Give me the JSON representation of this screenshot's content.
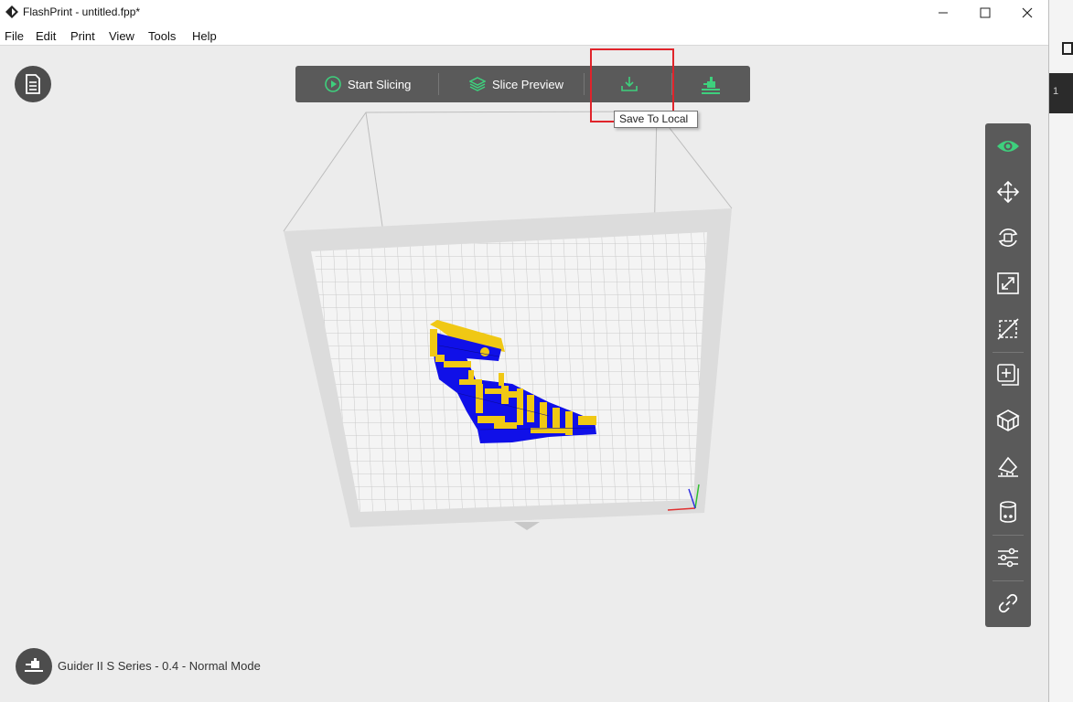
{
  "window": {
    "title": "FlashPrint - untitled.fpp*",
    "minimize_icon": "minimize-icon",
    "maximize_icon": "maximize-icon",
    "close_icon": "close-icon"
  },
  "menu": [
    "File",
    "Edit",
    "Print",
    "View",
    "Tools",
    "Help"
  ],
  "toolbar": {
    "start_slicing": "Start Slicing",
    "slice_preview": "Slice Preview",
    "save_local_icon": "download-icon",
    "send_icon": "printer-send-icon"
  },
  "tooltip": "Save To Local",
  "right_panel": [
    "eye-icon",
    "move-icon",
    "rotate-icon",
    "scale-icon",
    "cut-icon",
    "add-model-icon",
    "supports-icon",
    "lay-flat-icon",
    "cylinder-icon",
    "settings-sliders-icon",
    "link-icon"
  ],
  "status": "Guider II S Series - 0.4 - Normal Mode",
  "side_strip_text": "1",
  "colors": {
    "accent": "#3ed07d",
    "highlight": "#e0242b",
    "model_blue": "#1010e8",
    "model_yellow": "#f0c814"
  }
}
